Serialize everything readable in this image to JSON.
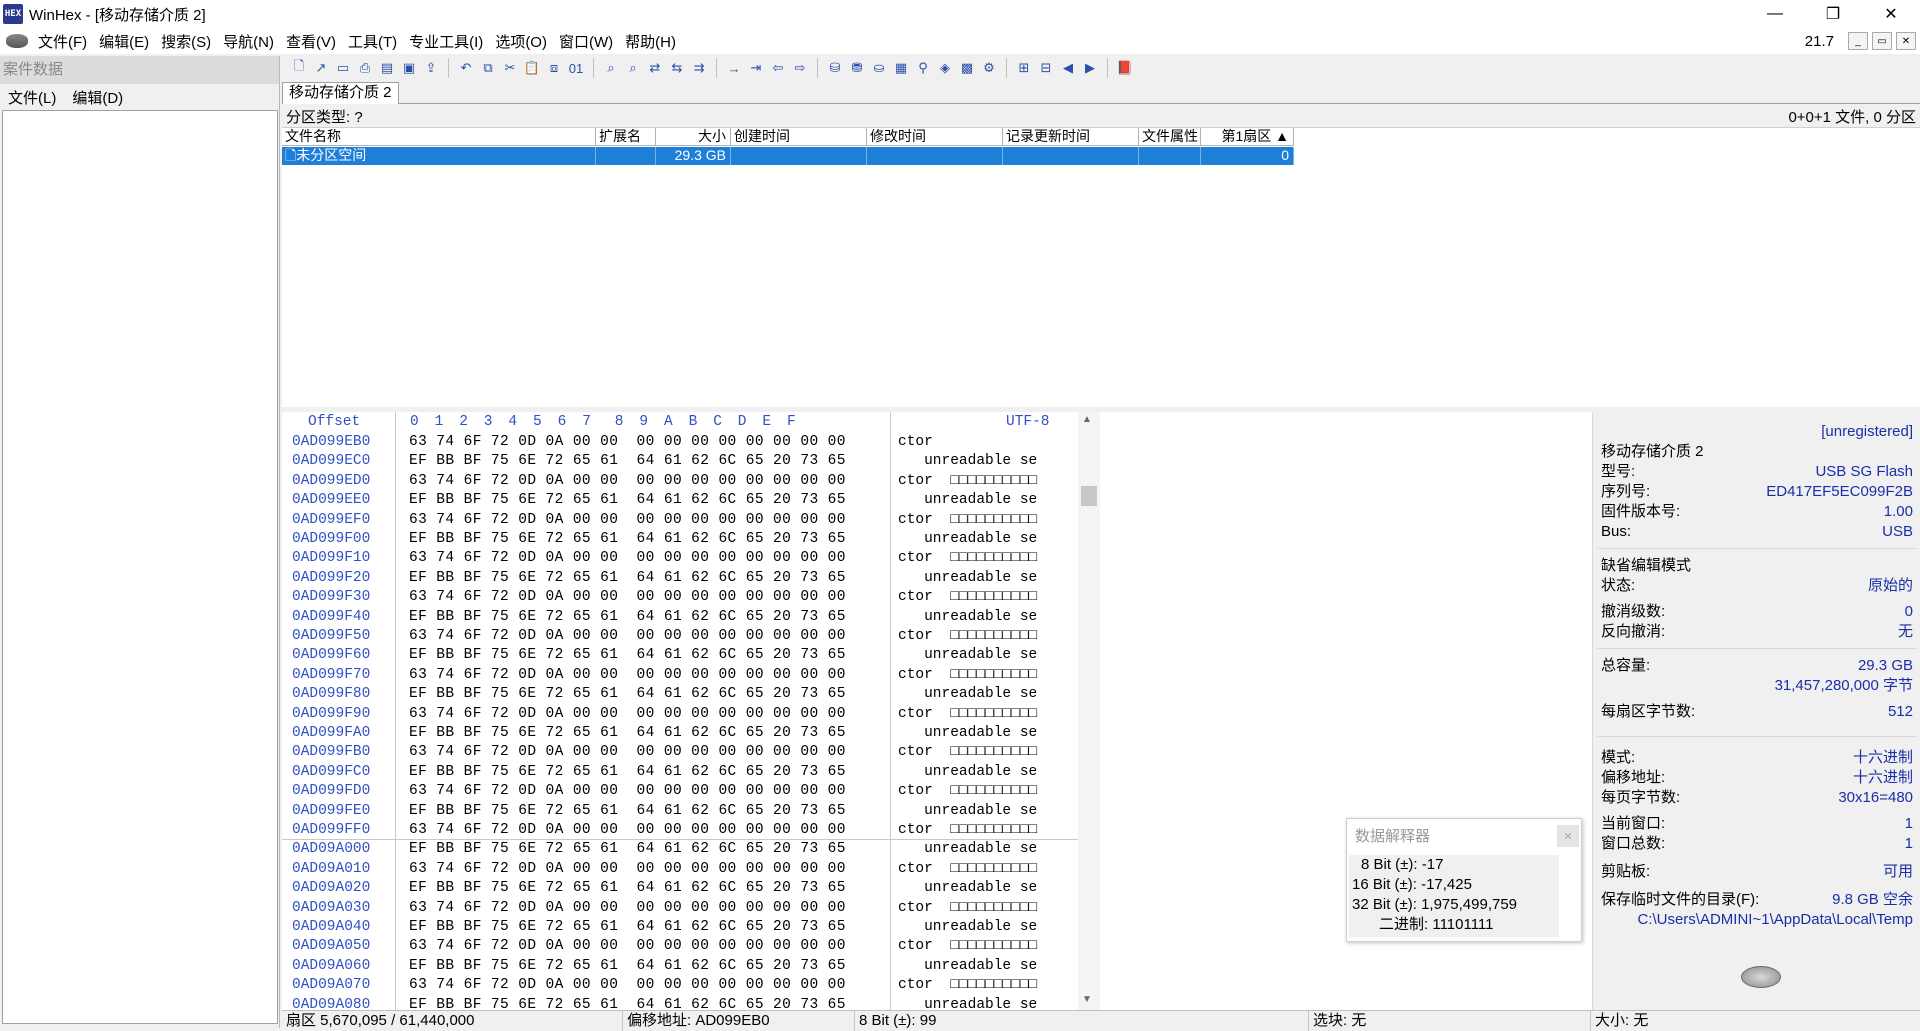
{
  "window": {
    "title": "WinHex - [移动存储介质 2]",
    "app_icon": "HEX",
    "minimize_icon": "—",
    "restore_icon": "❐",
    "close_icon": "✕"
  },
  "menu": {
    "items": [
      "文件(F)",
      "编辑(E)",
      "搜索(S)",
      "导航(N)",
      "查看(V)",
      "工具(T)",
      "专业工具(I)",
      "选项(O)",
      "窗口(W)",
      "帮助(H)"
    ],
    "zoom": "21.7"
  },
  "left_panel": {
    "header": "案件数据",
    "menu_file": "文件(L)",
    "menu_edit": "编辑(D)"
  },
  "tab": {
    "label": "移动存储介质 2"
  },
  "partition": {
    "type_label": "分区类型: ?",
    "summary": "0+0+1 文件, 0 分区"
  },
  "file_list": {
    "columns": [
      "文件名称",
      "扩展名",
      "大小",
      "创建时间",
      "修改时间",
      "记录更新时间",
      "文件属性",
      "第1扇区 ▲"
    ],
    "row": {
      "name": "未分区空间",
      "ext": "",
      "size": "29.3 GB",
      "created": "",
      "modified": "",
      "record": "",
      "attr": "",
      "first_sector": "0"
    }
  },
  "hex": {
    "offset_label": "Offset",
    "columns": [
      "0",
      "1",
      "2",
      "3",
      "4",
      "5",
      "6",
      "7",
      "8",
      "9",
      "A",
      "B",
      "C",
      "D",
      "E",
      "F"
    ],
    "charset": "UTF-8",
    "rows": [
      {
        "offset": "0AD099EB0",
        "bytes": "63 74 6F 72 0D 0A 00 00  00 00 00 00 00 00 00 00",
        "text": "ctor"
      },
      {
        "offset": "0AD099EC0",
        "bytes": "EF BB BF 75 6E 72 65 61  64 61 62 6C 65 20 73 65",
        "text": "   unreadable se"
      },
      {
        "offset": "0AD099ED0",
        "bytes": "63 74 6F 72 0D 0A 00 00  00 00 00 00 00 00 00 00",
        "text": "ctor  □□□□□□□□□□"
      },
      {
        "offset": "0AD099EE0",
        "bytes": "EF BB BF 75 6E 72 65 61  64 61 62 6C 65 20 73 65",
        "text": "   unreadable se"
      },
      {
        "offset": "0AD099EF0",
        "bytes": "63 74 6F 72 0D 0A 00 00  00 00 00 00 00 00 00 00",
        "text": "ctor  □□□□□□□□□□"
      },
      {
        "offset": "0AD099F00",
        "bytes": "EF BB BF 75 6E 72 65 61  64 61 62 6C 65 20 73 65",
        "text": "   unreadable se"
      },
      {
        "offset": "0AD099F10",
        "bytes": "63 74 6F 72 0D 0A 00 00  00 00 00 00 00 00 00 00",
        "text": "ctor  □□□□□□□□□□"
      },
      {
        "offset": "0AD099F20",
        "bytes": "EF BB BF 75 6E 72 65 61  64 61 62 6C 65 20 73 65",
        "text": "   unreadable se"
      },
      {
        "offset": "0AD099F30",
        "bytes": "63 74 6F 72 0D 0A 00 00  00 00 00 00 00 00 00 00",
        "text": "ctor  □□□□□□□□□□"
      },
      {
        "offset": "0AD099F40",
        "bytes": "EF BB BF 75 6E 72 65 61  64 61 62 6C 65 20 73 65",
        "text": "   unreadable se"
      },
      {
        "offset": "0AD099F50",
        "bytes": "63 74 6F 72 0D 0A 00 00  00 00 00 00 00 00 00 00",
        "text": "ctor  □□□□□□□□□□"
      },
      {
        "offset": "0AD099F60",
        "bytes": "EF BB BF 75 6E 72 65 61  64 61 62 6C 65 20 73 65",
        "text": "   unreadable se"
      },
      {
        "offset": "0AD099F70",
        "bytes": "63 74 6F 72 0D 0A 00 00  00 00 00 00 00 00 00 00",
        "text": "ctor  □□□□□□□□□□"
      },
      {
        "offset": "0AD099F80",
        "bytes": "EF BB BF 75 6E 72 65 61  64 61 62 6C 65 20 73 65",
        "text": "   unreadable se"
      },
      {
        "offset": "0AD099F90",
        "bytes": "63 74 6F 72 0D 0A 00 00  00 00 00 00 00 00 00 00",
        "text": "ctor  □□□□□□□□□□"
      },
      {
        "offset": "0AD099FA0",
        "bytes": "EF BB BF 75 6E 72 65 61  64 61 62 6C 65 20 73 65",
        "text": "   unreadable se"
      },
      {
        "offset": "0AD099FB0",
        "bytes": "63 74 6F 72 0D 0A 00 00  00 00 00 00 00 00 00 00",
        "text": "ctor  □□□□□□□□□□"
      },
      {
        "offset": "0AD099FC0",
        "bytes": "EF BB BF 75 6E 72 65 61  64 61 62 6C 65 20 73 65",
        "text": "   unreadable se"
      },
      {
        "offset": "0AD099FD0",
        "bytes": "63 74 6F 72 0D 0A 00 00  00 00 00 00 00 00 00 00",
        "text": "ctor  □□□□□□□□□□"
      },
      {
        "offset": "0AD099FE0",
        "bytes": "EF BB BF 75 6E 72 65 61  64 61 62 6C 65 20 73 65",
        "text": "   unreadable se"
      },
      {
        "offset": "0AD099FF0",
        "bytes": "63 74 6F 72 0D 0A 00 00  00 00 00 00 00 00 00 00",
        "text": "ctor  □□□□□□□□□□"
      },
      {
        "offset": "0AD09A000",
        "bytes": "EF BB BF 75 6E 72 65 61  64 61 62 6C 65 20 73 65",
        "text": "   unreadable se"
      },
      {
        "offset": "0AD09A010",
        "bytes": "63 74 6F 72 0D 0A 00 00  00 00 00 00 00 00 00 00",
        "text": "ctor  □□□□□□□□□□"
      },
      {
        "offset": "0AD09A020",
        "bytes": "EF BB BF 75 6E 72 65 61  64 61 62 6C 65 20 73 65",
        "text": "   unreadable se"
      },
      {
        "offset": "0AD09A030",
        "bytes": "63 74 6F 72 0D 0A 00 00  00 00 00 00 00 00 00 00",
        "text": "ctor  □□□□□□□□□□"
      },
      {
        "offset": "0AD09A040",
        "bytes": "EF BB BF 75 6E 72 65 61  64 61 62 6C 65 20 73 65",
        "text": "   unreadable se"
      },
      {
        "offset": "0AD09A050",
        "bytes": "63 74 6F 72 0D 0A 00 00  00 00 00 00 00 00 00 00",
        "text": "ctor  □□□□□□□□□□"
      },
      {
        "offset": "0AD09A060",
        "bytes": "EF BB BF 75 6E 72 65 61  64 61 62 6C 65 20 73 65",
        "text": "   unreadable se"
      },
      {
        "offset": "0AD09A070",
        "bytes": "63 74 6F 72 0D 0A 00 00  00 00 00 00 00 00 00 00",
        "text": "ctor  □□□□□□□□□□"
      },
      {
        "offset": "0AD09A080",
        "bytes": "EF BB BF 75 6E 72 65 61  64 61 62 6C 65 20 73 65",
        "text": "   unreadable se"
      }
    ]
  },
  "interpreter": {
    "title": "数据解释器",
    "close_icon": "✕",
    "lines": [
      "8 Bit (±): -17",
      "16 Bit (±): -17,425",
      "32 Bit (±): 1,975,499,759",
      "二进制: 11101111"
    ]
  },
  "info": {
    "unregistered": "[unregistered]",
    "device": "移动存储介质 2",
    "model_label": "型号:",
    "model": "USB SG Flash",
    "serial_label": "序列号:",
    "serial": "ED417EF5EC099F2B",
    "firmware_label": "固件版本号:",
    "firmware": "1.00",
    "bus_label": "Bus:",
    "bus": "USB",
    "edit_mode": "缺省编辑模式",
    "state_label": "状态:",
    "state": "原始的",
    "undo_label": "撤消级数:",
    "undo": "0",
    "redo_label": "反向撤消:",
    "redo": "无",
    "capacity_label": "总容量:",
    "capacity": "29.3 GB",
    "capacity_bytes": "31,457,280,000 字节",
    "bps_label": "每扇区字节数:",
    "bps": "512",
    "mode_label": "模式:",
    "mode": "十六进制",
    "offset_addr_label": "偏移地址:",
    "offset_addr": "十六进制",
    "bpp_label": "每页字节数:",
    "bpp": "30x16=480",
    "cur_win_label": "当前窗口:",
    "cur_win": "1",
    "win_total_label": "窗口总数:",
    "win_total": "1",
    "clipboard_label": "剪贴板:",
    "clipboard": "可用",
    "temp_label": "保存临时文件的目录(F):",
    "temp_free": "9.8 GB 空余",
    "temp_path": "C:\\Users\\ADMINI~1\\AppData\\Local\\Temp"
  },
  "status": {
    "sector": "扇区 5,670,095 / 61,440,000",
    "offset": "偏移地址: AD099EB0",
    "bit8": "8 Bit (±): 99",
    "selection": "选块: 无",
    "size": "大小: 无"
  }
}
